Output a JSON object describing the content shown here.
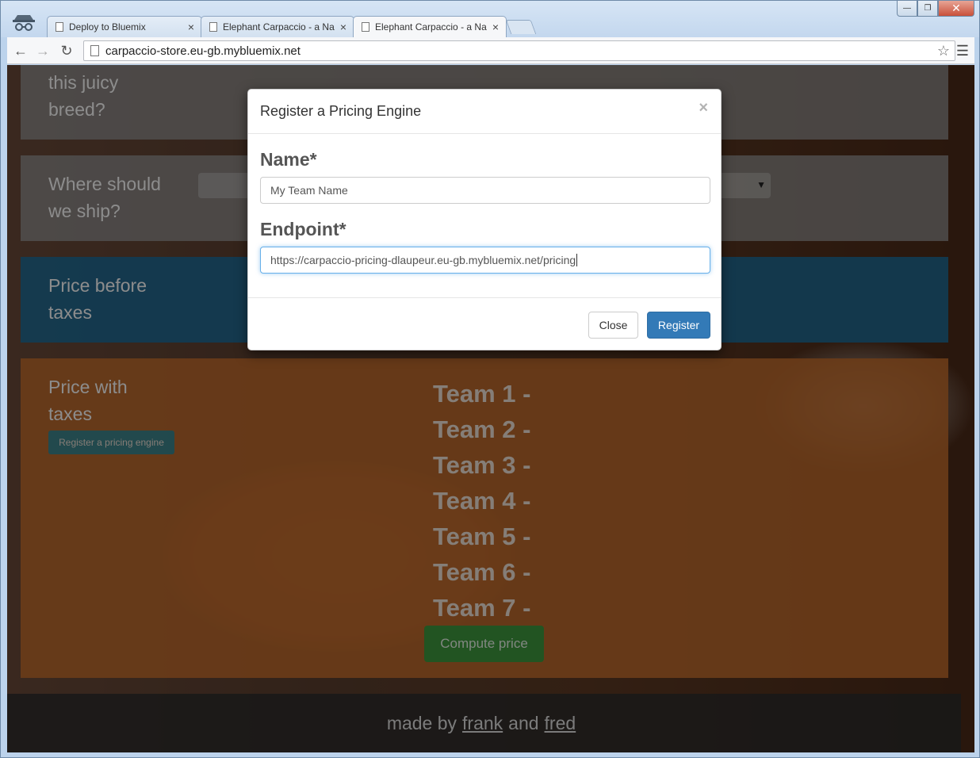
{
  "browser": {
    "tabs": [
      {
        "label": "Deploy to Bluemix",
        "close": "×",
        "active": false
      },
      {
        "label": "Elephant Carpaccio - a Na",
        "close": "×",
        "active": false
      },
      {
        "label": "Elephant Carpaccio - a Na",
        "close": "×",
        "active": true
      }
    ],
    "url": "carpaccio-store.eu-gb.mybluemix.net",
    "icons": {
      "back": "back-arrow-icon",
      "forward": "forward-arrow-icon",
      "reload": "reload-icon",
      "star": "bookmark-star-icon",
      "menu": "hamburger-menu-icon"
    }
  },
  "page": {
    "breed_question": "this juicy\nbreed?",
    "ship_question": "Where should\nwe ship?",
    "price_before_taxes": "Price before\ntaxes",
    "price_with_taxes": "Price with\ntaxes",
    "register_small_button": "Register a pricing engine",
    "teams": [
      "Team 1 -",
      "Team 2 -",
      "Team 3 -",
      "Team 4 -",
      "Team 5 -",
      "Team 6 -",
      "Team 7 -"
    ],
    "compute_button": "Compute price",
    "footer": {
      "prefix": "made by",
      "author1": "frank",
      "conjunction": "and",
      "author2": "fred"
    }
  },
  "modal": {
    "title": "Register a Pricing Engine",
    "close_symbol": "×",
    "name_label": "Name*",
    "name_value": "My Team Name",
    "endpoint_label": "Endpoint*",
    "endpoint_value": "https://carpaccio-pricing-dlaupeur.eu-gb.mybluemix.net/pricing",
    "close_button": "Close",
    "register_button": "Register"
  },
  "colors": {
    "primary_button": "#337ab7",
    "compute_button": "#3f9a3e",
    "blue_panel": "#1e6e9b",
    "orange_panel": "#c46e2d"
  }
}
